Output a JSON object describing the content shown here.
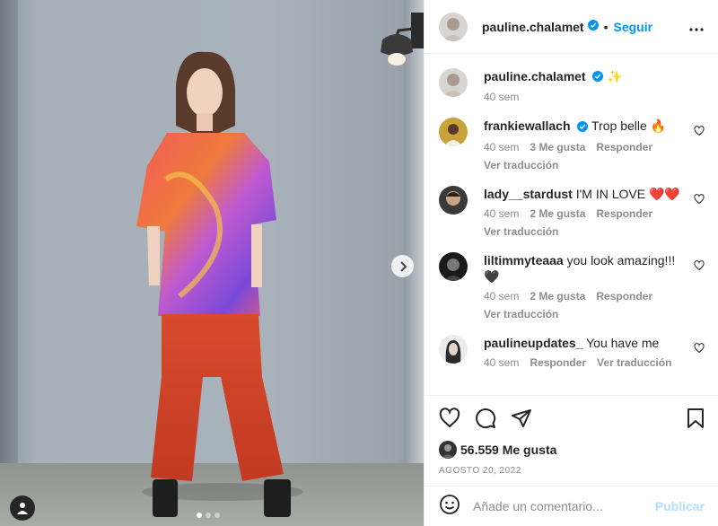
{
  "post": {
    "author": "pauline.chalamet",
    "follow_label": "Seguir",
    "separator": "•",
    "caption_emoji": "✨",
    "caption_time": "40 sem",
    "carousel": {
      "slides": 3,
      "active_index": 0
    }
  },
  "comments": [
    {
      "user": "frankiewallach",
      "verified": true,
      "text": "Trop belle 🔥",
      "time": "40 sem",
      "likes": "3 Me gusta",
      "reply": "Responder",
      "translate": "Ver traducción"
    },
    {
      "user": "lady__stardust",
      "verified": false,
      "text": "I'M IN LOVE ❤️❤️",
      "time": "40 sem",
      "likes": "2 Me gusta",
      "reply": "Responder",
      "translate": "Ver traducción"
    },
    {
      "user": "liltimmyteaaa",
      "verified": false,
      "text": "you look amazing!!! 🖤",
      "time": "40 sem",
      "likes": "2 Me gusta",
      "reply": "Responder",
      "translate": "Ver traducción"
    },
    {
      "user": "paulineupdates_",
      "verified": false,
      "text": "You have me",
      "time": "40 sem",
      "likes": "",
      "reply": "Responder",
      "translate": "Ver traducción"
    }
  ],
  "stats": {
    "likes": "56.559 Me gusta",
    "date": "AGOSTO 20, 2022"
  },
  "composer": {
    "placeholder": "Añade un comentario...",
    "publish_label": "Publicar"
  },
  "colors": {
    "accent": "#0095f6",
    "verified": "#0095f6",
    "publish_disabled": "#b2dffc"
  }
}
